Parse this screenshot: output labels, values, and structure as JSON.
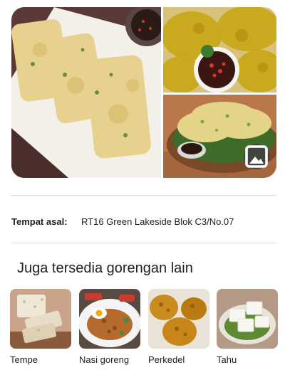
{
  "gallery": {
    "main_image_icon": "fritter-photo",
    "top_right_image_icon": "fritter-photo",
    "bottom_right_image_icon": "fritter-photo",
    "more_images_icon": "image-icon"
  },
  "origin": {
    "label": "Tempat asal:",
    "value": "RT16 Green Lakeside Blok C3/No.07"
  },
  "related": {
    "title": "Juga tersedia gorengan lain",
    "items": [
      {
        "label": "Tempe"
      },
      {
        "label": "Nasi goreng"
      },
      {
        "label": "Perkedel"
      },
      {
        "label": "Tahu"
      }
    ]
  }
}
